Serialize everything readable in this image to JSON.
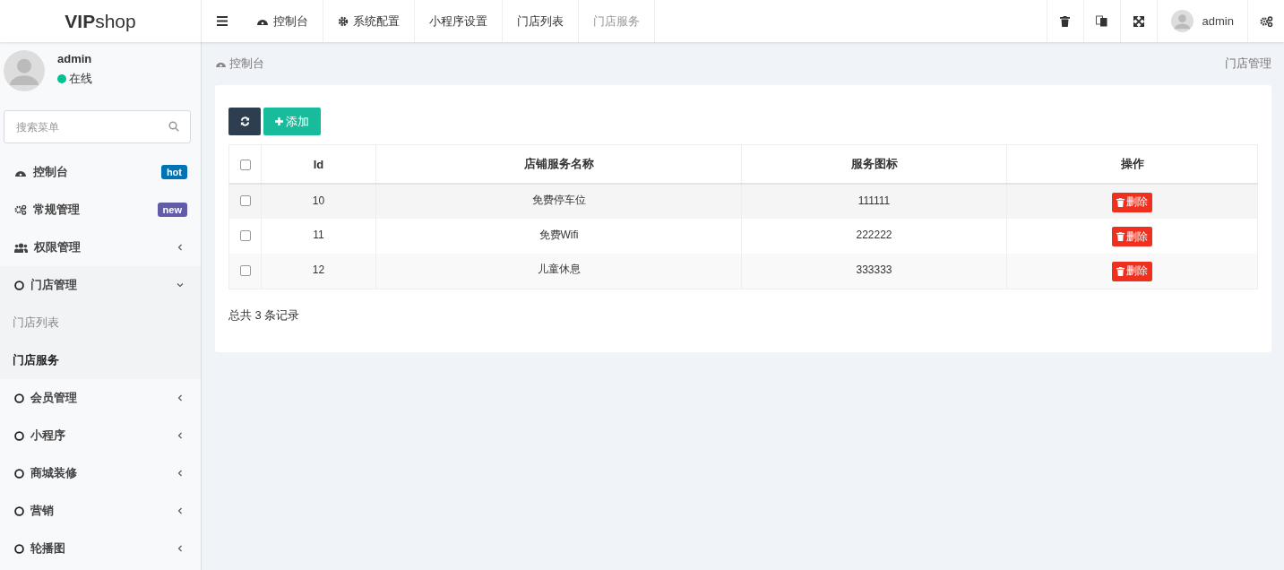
{
  "logo": "**VIP**shop",
  "top_nav": [
    {
      "label": "控制台",
      "kind": "dashboard",
      "selected": false
    },
    {
      "label": "系统配置",
      "kind": "gear",
      "selected": false
    },
    {
      "label": "小程序设置",
      "kind": "plain",
      "selected": false
    },
    {
      "label": "门店列表",
      "kind": "plain",
      "selected": false
    },
    {
      "label": "门店服务",
      "kind": "plain",
      "selected": true
    }
  ],
  "user_menu": {
    "name": "admin"
  },
  "sidebar": {
    "user": {
      "name": "admin",
      "status": {
        "text": "在线",
        "color": "#00c292"
      }
    },
    "search": {
      "placeholder": "搜索菜单"
    },
    "items": [
      {
        "label": "控制台",
        "kind": "dashboard",
        "badge": {
          "text": "hot",
          "color": "#0073b7"
        }
      },
      {
        "label": "常规管理",
        "kind": "gears",
        "badge": {
          "text": "new",
          "color": "#605ca8"
        }
      },
      {
        "label": "权限管理",
        "kind": "users",
        "expanded": false
      },
      {
        "label": "门店管理",
        "kind": "circle",
        "expanded": true,
        "children": [
          {
            "label": "门店列表",
            "selected": false
          },
          {
            "label": "门店服务",
            "selected": true
          }
        ]
      },
      {
        "label": "会员管理",
        "kind": "circle",
        "expanded": false
      },
      {
        "label": "小程序",
        "kind": "circle",
        "expanded": false
      },
      {
        "label": "商城装修",
        "kind": "circle",
        "expanded": false
      },
      {
        "label": "营销",
        "kind": "circle",
        "expanded": false
      },
      {
        "label": "轮播图",
        "kind": "circle",
        "expanded": false
      }
    ]
  },
  "breadcrumb": {
    "current": "控制台",
    "section": "门店管理"
  },
  "toolbar": {
    "add_label": "添加"
  },
  "table": {
    "columns": [
      "Id",
      "店铺服务名称",
      "服务图标",
      "操作"
    ],
    "select_all_checked": false,
    "rows": [
      {
        "checked": false,
        "id": "10",
        "name": "免费停车位",
        "icon": "111111",
        "action": "删除"
      },
      {
        "checked": false,
        "id": "11",
        "name": "免费Wifi",
        "icon": "222222",
        "action": "删除"
      },
      {
        "checked": false,
        "id": "12",
        "name": "儿童休息",
        "icon": "333333",
        "action": "删除"
      }
    ]
  },
  "total_text": "总共 3 条记录"
}
